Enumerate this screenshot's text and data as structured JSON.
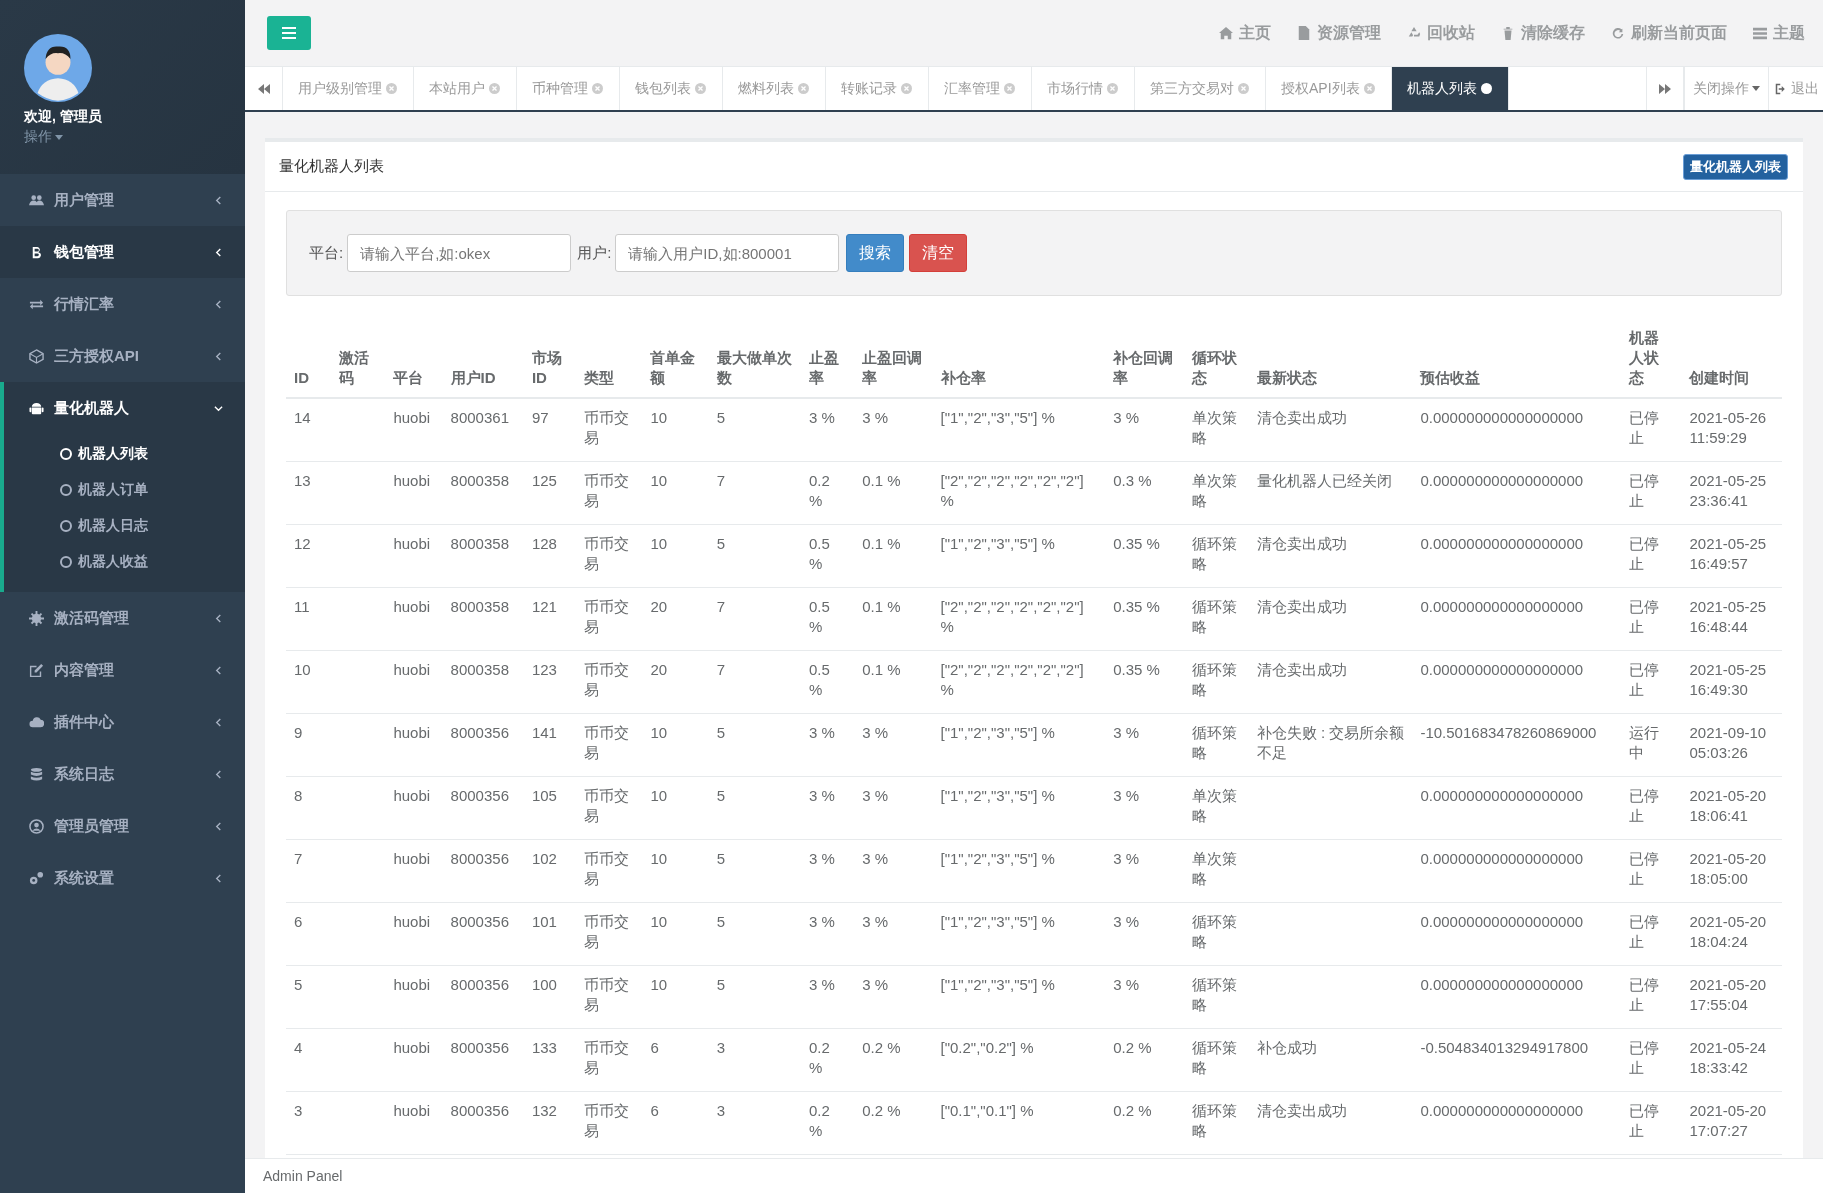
{
  "sidebar": {
    "welcome": "欢迎, 管理员",
    "user_menu": "操作",
    "items": [
      {
        "label": "用户管理",
        "selected": false,
        "expanded": false
      },
      {
        "label": "钱包管理",
        "selected": true,
        "expanded": false
      },
      {
        "label": "行情汇率",
        "selected": false,
        "expanded": false
      },
      {
        "label": "三方授权API",
        "selected": false,
        "expanded": false
      },
      {
        "label": "量化机器人",
        "selected": true,
        "expanded": true,
        "children": [
          {
            "label": "机器人列表",
            "selected": true
          },
          {
            "label": "机器人订单",
            "selected": false
          },
          {
            "label": "机器人日志",
            "selected": false
          },
          {
            "label": "机器人收益",
            "selected": false
          }
        ]
      },
      {
        "label": "激活码管理",
        "selected": false,
        "expanded": false
      },
      {
        "label": "内容管理",
        "selected": false,
        "expanded": false
      },
      {
        "label": "插件中心",
        "selected": false,
        "expanded": false
      },
      {
        "label": "系统日志",
        "selected": false,
        "expanded": false
      },
      {
        "label": "管理员管理",
        "selected": false,
        "expanded": false
      },
      {
        "label": "系统设置",
        "selected": false,
        "expanded": false
      }
    ]
  },
  "topbar": {
    "links": [
      {
        "label": "主页"
      },
      {
        "label": "资源管理"
      },
      {
        "label": "回收站"
      },
      {
        "label": "清除缓存"
      },
      {
        "label": "刷新当前页面"
      },
      {
        "label": "主题"
      }
    ]
  },
  "tabs": [
    {
      "label": "用户级别管理",
      "selected": false
    },
    {
      "label": "本站用户",
      "selected": false
    },
    {
      "label": "币种管理",
      "selected": false
    },
    {
      "label": "钱包列表",
      "selected": false
    },
    {
      "label": "燃料列表",
      "selected": false
    },
    {
      "label": "转账记录",
      "selected": false
    },
    {
      "label": "汇率管理",
      "selected": false
    },
    {
      "label": "市场行情",
      "selected": false
    },
    {
      "label": "第三方交易对",
      "selected": false
    },
    {
      "label": "授权API列表",
      "selected": false
    },
    {
      "label": "机器人列表",
      "selected": true
    }
  ],
  "tab_actions": {
    "close_menu": "关闭操作",
    "logout": "退出"
  },
  "panel": {
    "title": "量化机器人列表",
    "badge": "量化机器人列表"
  },
  "search": {
    "platform_label": "平台:",
    "platform_placeholder": "请输入平台,如:okex",
    "user_label": "用户:",
    "user_placeholder": "请输入用户ID,如:800001",
    "search_button": "搜索",
    "clear_button": "清空"
  },
  "table": {
    "columns": [
      "ID",
      "激活码",
      "平台",
      "用户ID",
      "市场ID",
      "类型",
      "首单金额",
      "最大做单次数",
      "止盈率",
      "止盈回调率",
      "补仓率",
      "补仓回调率",
      "循环状态",
      "最新状态",
      "预估收益",
      "机器人状态",
      "创建时间"
    ],
    "rows": [
      [
        "14",
        null,
        "huobi",
        "8000361",
        "97",
        "币币交易",
        "10",
        "5",
        "3 %",
        "3 %",
        "[\"1\",\"2\",\"3\",\"5\"] %",
        "3 %",
        "单次策略",
        "清仓卖出成功",
        "0.000000000000000000",
        "已停止",
        "2021-05-26 11:59:29"
      ],
      [
        "13",
        null,
        "huobi",
        "8000358",
        "125",
        "币币交易",
        "10",
        "7",
        "0.2 %",
        "0.1 %",
        "[\"2\",\"2\",\"2\",\"2\",\"2\",\"2\"] %",
        "0.3 %",
        "单次策略",
        "量化机器人已经关闭",
        "0.000000000000000000",
        "已停止",
        "2021-05-25 23:36:41"
      ],
      [
        "12",
        null,
        "huobi",
        "8000358",
        "128",
        "币币交易",
        "10",
        "5",
        "0.5 %",
        "0.1 %",
        "[\"1\",\"2\",\"3\",\"5\"] %",
        "0.35 %",
        "循环策略",
        "清仓卖出成功",
        "0.000000000000000000",
        "已停止",
        "2021-05-25 16:49:57"
      ],
      [
        "11",
        null,
        "huobi",
        "8000358",
        "121",
        "币币交易",
        "20",
        "7",
        "0.5 %",
        "0.1 %",
        "[\"2\",\"2\",\"2\",\"2\",\"2\",\"2\"] %",
        "0.35 %",
        "循环策略",
        "清仓卖出成功",
        "0.000000000000000000",
        "已停止",
        "2021-05-25 16:48:44"
      ],
      [
        "10",
        null,
        "huobi",
        "8000358",
        "123",
        "币币交易",
        "20",
        "7",
        "0.5 %",
        "0.1 %",
        "[\"2\",\"2\",\"2\",\"2\",\"2\",\"2\"] %",
        "0.35 %",
        "循环策略",
        "清仓卖出成功",
        "0.000000000000000000",
        "已停止",
        "2021-05-25 16:49:30"
      ],
      [
        "9",
        null,
        "huobi",
        "8000356",
        "141",
        "币币交易",
        "10",
        "5",
        "3 %",
        "3 %",
        "[\"1\",\"2\",\"3\",\"5\"] %",
        "3 %",
        "循环策略",
        "补仓失败 : 交易所余额不足",
        "-10.501683478260869000",
        "运行中",
        "2021-09-10 05:03:26"
      ],
      [
        "8",
        null,
        "huobi",
        "8000356",
        "105",
        "币币交易",
        "10",
        "5",
        "3 %",
        "3 %",
        "[\"1\",\"2\",\"3\",\"5\"] %",
        "3 %",
        "单次策略",
        null,
        "0.000000000000000000",
        "已停止",
        "2021-05-20 18:06:41"
      ],
      [
        "7",
        null,
        "huobi",
        "8000356",
        "102",
        "币币交易",
        "10",
        "5",
        "3 %",
        "3 %",
        "[\"1\",\"2\",\"3\",\"5\"] %",
        "3 %",
        "单次策略",
        null,
        "0.000000000000000000",
        "已停止",
        "2021-05-20 18:05:00"
      ],
      [
        "6",
        null,
        "huobi",
        "8000356",
        "101",
        "币币交易",
        "10",
        "5",
        "3 %",
        "3 %",
        "[\"1\",\"2\",\"3\",\"5\"] %",
        "3 %",
        "循环策略",
        null,
        "0.000000000000000000",
        "已停止",
        "2021-05-20 18:04:24"
      ],
      [
        "5",
        null,
        "huobi",
        "8000356",
        "100",
        "币币交易",
        "10",
        "5",
        "3 %",
        "3 %",
        "[\"1\",\"2\",\"3\",\"5\"] %",
        "3 %",
        "循环策略",
        null,
        "0.000000000000000000",
        "已停止",
        "2021-05-20 17:55:04"
      ],
      [
        "4",
        null,
        "huobi",
        "8000356",
        "133",
        "币币交易",
        "6",
        "3",
        "0.2 %",
        "0.2 %",
        "[\"0.2\",\"0.2\"] %",
        "0.2 %",
        "循环策略",
        "补仓成功",
        "-0.504834013294917800",
        "已停止",
        "2021-05-24 18:33:42"
      ],
      [
        "3",
        null,
        "huobi",
        "8000356",
        "132",
        "币币交易",
        "6",
        "3",
        "0.2 %",
        "0.2 %",
        "[\"0.1\",\"0.1\"] %",
        "0.2 %",
        "循环策略",
        "清仓卖出成功",
        "0.000000000000000000",
        "已停止",
        "2021-05-20 17:07:27"
      ]
    ]
  },
  "footer": "Admin Panel"
}
